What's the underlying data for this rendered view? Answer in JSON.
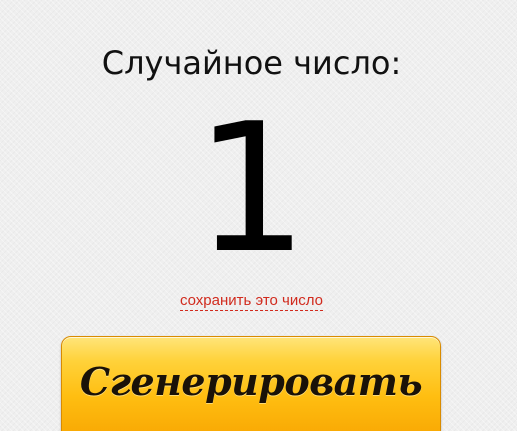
{
  "heading": "Случайное число:",
  "result": {
    "value": "1"
  },
  "save_link": {
    "label": "сохранить это число"
  },
  "generate_button": {
    "label": "Сгенерировать"
  },
  "colors": {
    "background": "#efefef",
    "link": "#d12b1e",
    "button_top": "#ffe57a",
    "button_bottom": "#f7a300",
    "button_border": "#d98b00"
  }
}
